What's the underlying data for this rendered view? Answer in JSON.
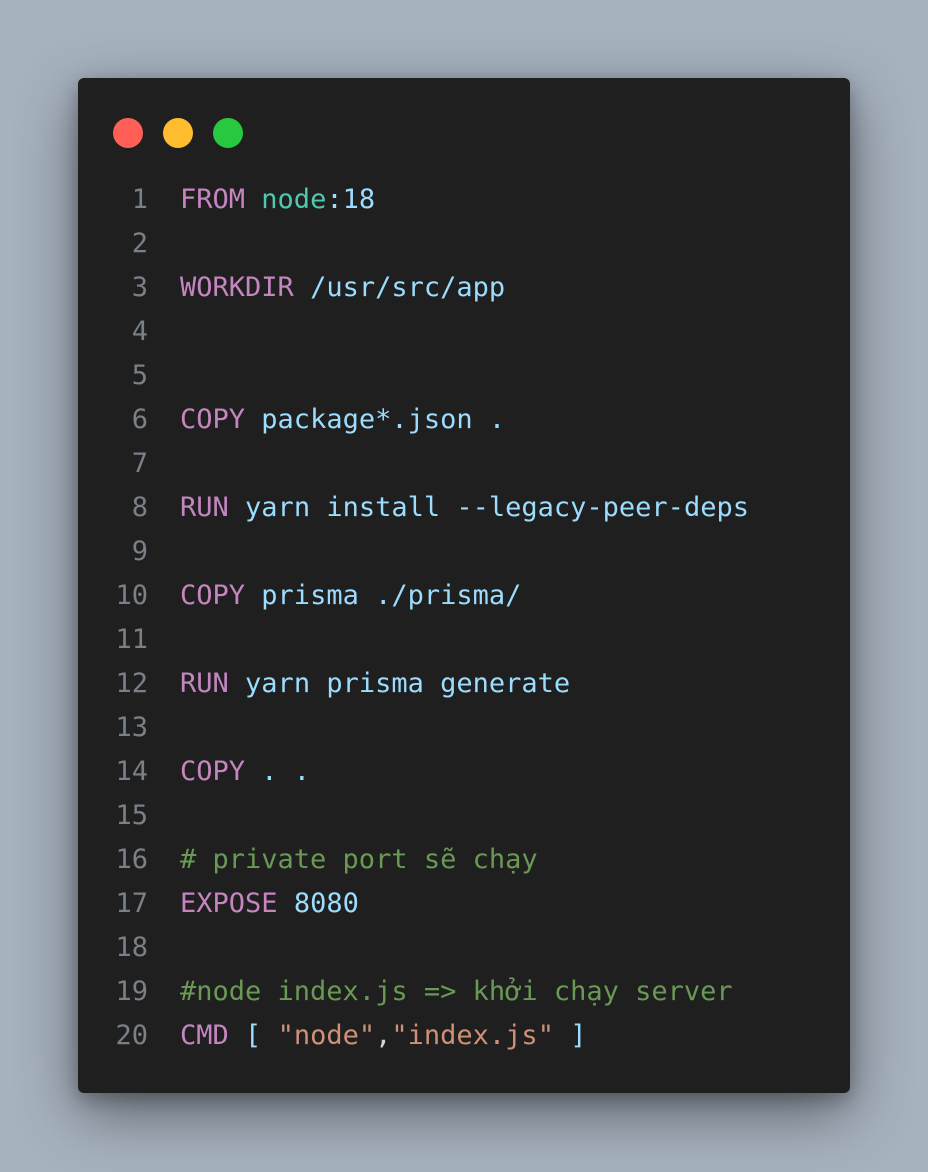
{
  "colors": {
    "background": "#a7b2bf",
    "window": "#1f1f1f",
    "line_number": "#7a8088",
    "keyword": "#c586c0",
    "image": "#4ec9b0",
    "value": "#9cdcfe",
    "number": "#b5cea8",
    "comment": "#6a9955",
    "string": "#ce9178",
    "punctuation": "#d4d4d4"
  },
  "window_dots": [
    {
      "name": "close",
      "color": "#ff5f57"
    },
    {
      "name": "minimize",
      "color": "#febc2e"
    },
    {
      "name": "maximize",
      "color": "#28c840"
    }
  ],
  "lines": [
    {
      "n": "1",
      "tokens": [
        {
          "t": "FROM",
          "c": "keyword"
        },
        {
          "t": " "
        },
        {
          "t": "node",
          "c": "image"
        },
        {
          "t": ":",
          "c": "value"
        },
        {
          "t": "18",
          "c": "value"
        }
      ]
    },
    {
      "n": "2",
      "tokens": []
    },
    {
      "n": "3",
      "tokens": [
        {
          "t": "WORKDIR",
          "c": "keyword"
        },
        {
          "t": " "
        },
        {
          "t": "/usr/src/app",
          "c": "value"
        }
      ]
    },
    {
      "n": "4",
      "tokens": []
    },
    {
      "n": "5",
      "tokens": []
    },
    {
      "n": "6",
      "tokens": [
        {
          "t": "COPY",
          "c": "keyword"
        },
        {
          "t": " "
        },
        {
          "t": "package*.json .",
          "c": "value"
        }
      ]
    },
    {
      "n": "7",
      "tokens": []
    },
    {
      "n": "8",
      "tokens": [
        {
          "t": "RUN",
          "c": "keyword"
        },
        {
          "t": " "
        },
        {
          "t": "yarn install --legacy-peer-deps",
          "c": "value"
        }
      ]
    },
    {
      "n": "9",
      "tokens": []
    },
    {
      "n": "10",
      "tokens": [
        {
          "t": "COPY",
          "c": "keyword"
        },
        {
          "t": " "
        },
        {
          "t": "prisma ./prisma/",
          "c": "value"
        }
      ]
    },
    {
      "n": "11",
      "tokens": []
    },
    {
      "n": "12",
      "tokens": [
        {
          "t": "RUN",
          "c": "keyword"
        },
        {
          "t": " "
        },
        {
          "t": "yarn prisma generate",
          "c": "value"
        }
      ]
    },
    {
      "n": "13",
      "tokens": []
    },
    {
      "n": "14",
      "tokens": [
        {
          "t": "COPY",
          "c": "keyword"
        },
        {
          "t": " "
        },
        {
          "t": ". .",
          "c": "value"
        }
      ]
    },
    {
      "n": "15",
      "tokens": []
    },
    {
      "n": "16",
      "tokens": [
        {
          "t": "# private port sẽ chạy",
          "c": "comment"
        }
      ]
    },
    {
      "n": "17",
      "tokens": [
        {
          "t": "EXPOSE",
          "c": "keyword"
        },
        {
          "t": " "
        },
        {
          "t": "8080",
          "c": "value"
        }
      ]
    },
    {
      "n": "18",
      "tokens": []
    },
    {
      "n": "19",
      "tokens": [
        {
          "t": "#node index.js => khởi chạy server",
          "c": "comment"
        }
      ]
    },
    {
      "n": "20",
      "tokens": [
        {
          "t": "CMD",
          "c": "keyword"
        },
        {
          "t": " "
        },
        {
          "t": "[",
          "c": "value"
        },
        {
          "t": " "
        },
        {
          "t": "\"node\"",
          "c": "string"
        },
        {
          "t": ",",
          "c": "punctuation"
        },
        {
          "t": "\"index.js\"",
          "c": "string"
        },
        {
          "t": " "
        },
        {
          "t": "]",
          "c": "value"
        }
      ]
    }
  ]
}
